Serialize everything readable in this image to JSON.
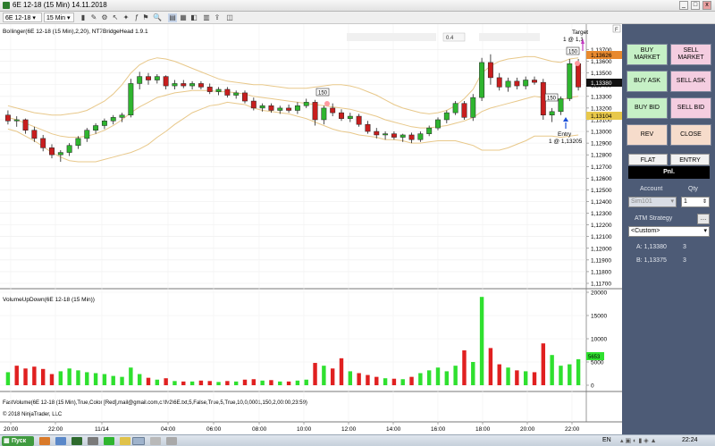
{
  "window": {
    "title": "6E 12-18 (15 Min)  14.11.2018"
  },
  "toolbar": {
    "instrument": "6E 12-18",
    "interval": "15 Min"
  },
  "indicators": {
    "price_label": "Bollinger(6E 12-18 (15 Min),2,20), NT7BridgeHead 1.9.1",
    "volume_label": "VolumeUpDown(6E 12-18 (15 Min))",
    "fastvolume_label": "FastVolume(6E 12-18 (15 Min),True,Color [Red],mail@gmail.com,c:\\fv2\\6E.txt,5,False,True,5,True,10,0,0001,150,2,00:00,23:59)",
    "copyright": "© 2018 NinjaTrader, LLC",
    "field_value": "0.4"
  },
  "price_axis": {
    "ticks": [
      "1,13700",
      "1,13600",
      "1,13500",
      "1,13400",
      "1,13300",
      "1,13200",
      "1,13100",
      "1,13000",
      "1,12900",
      "1,12800",
      "1,12700",
      "1,12600",
      "1,12500",
      "1,12400",
      "1,12300",
      "1,12200",
      "1,12100",
      "1,12000",
      "1,11900",
      "1,11800",
      "1,11700"
    ],
    "target_price": "1,13626",
    "last_price": "1,13380",
    "entry_price": "1,13104"
  },
  "volume_axis": {
    "ticks": [
      "20000",
      "15000",
      "10000",
      "5000",
      "0"
    ],
    "last_volume": "5653"
  },
  "time_axis": {
    "ticks": [
      "20:00",
      "22:00",
      "11/14",
      "04:00",
      "06:00",
      "08:00",
      "10:00",
      "12:00",
      "14:00",
      "16:00",
      "18:00",
      "20:00",
      "22:00"
    ]
  },
  "annotations": {
    "target_line1": "Target",
    "target_line2": "1 @ 1,1",
    "entry_line1": "Entry",
    "entry_line2": "1 @ 1,13205",
    "marker_a": "150",
    "marker_b": "150",
    "marker_c": "150"
  },
  "panel": {
    "buy_market": "BUY MARKET",
    "sell_market": "SELL MARKET",
    "buy_ask": "BUY ASK",
    "sell_ask": "SELL ASK",
    "buy_bid": "BUY BID",
    "sell_bid": "SELL BID",
    "rev": "REV",
    "close": "CLOSE",
    "flat": "FLAT",
    "entry": "ENTRY",
    "pnl": "Pnl.",
    "account_label": "Account",
    "qty_label": "Qty",
    "account_value": "Sim101",
    "qty_value": "1",
    "atm_label": "ATM Strategy",
    "atm_value": "<Custom>",
    "row_a_label": "A: 1,13380",
    "row_a_value": "3",
    "row_b_label": "B: 1,13375",
    "row_b_value": "3"
  },
  "taskbar": {
    "start_label": "Пуск",
    "lang": "EN",
    "clock": "22:24"
  },
  "colors": {
    "up_candle": "#2fb52f",
    "down_candle": "#c81e1e",
    "bollinger": "#e8c88a",
    "volume_up": "#2fe02f",
    "volume_down": "#e02020",
    "panel_bg": "#4d5b76"
  },
  "chart_data": {
    "type": "candlestick",
    "title": "",
    "ylim": [
      1.117,
      1.1375
    ],
    "volume_ylim": [
      0,
      20000
    ],
    "candles": [
      {
        "o": 1.1314,
        "h": 1.1318,
        "l": 1.1306,
        "c": 1.1309
      },
      {
        "o": 1.1309,
        "h": 1.1313,
        "l": 1.1304,
        "c": 1.131
      },
      {
        "o": 1.131,
        "h": 1.1311,
        "l": 1.1298,
        "c": 1.1301
      },
      {
        "o": 1.1301,
        "h": 1.1304,
        "l": 1.1291,
        "c": 1.1294
      },
      {
        "o": 1.1294,
        "h": 1.1297,
        "l": 1.1283,
        "c": 1.1286
      },
      {
        "o": 1.1286,
        "h": 1.1289,
        "l": 1.1277,
        "c": 1.128
      },
      {
        "o": 1.128,
        "h": 1.1284,
        "l": 1.1274,
        "c": 1.1282
      },
      {
        "o": 1.1282,
        "h": 1.129,
        "l": 1.1279,
        "c": 1.1288
      },
      {
        "o": 1.1288,
        "h": 1.1296,
        "l": 1.1285,
        "c": 1.1294
      },
      {
        "o": 1.1294,
        "h": 1.1303,
        "l": 1.1291,
        "c": 1.1301
      },
      {
        "o": 1.1301,
        "h": 1.1307,
        "l": 1.1298,
        "c": 1.1305
      },
      {
        "o": 1.1305,
        "h": 1.1311,
        "l": 1.1302,
        "c": 1.1309
      },
      {
        "o": 1.1309,
        "h": 1.1314,
        "l": 1.1306,
        "c": 1.1312
      },
      {
        "o": 1.1312,
        "h": 1.1316,
        "l": 1.1308,
        "c": 1.1314
      },
      {
        "o": 1.1314,
        "h": 1.1345,
        "l": 1.1312,
        "c": 1.1341
      },
      {
        "o": 1.1341,
        "h": 1.1351,
        "l": 1.1336,
        "c": 1.1347
      },
      {
        "o": 1.1347,
        "h": 1.135,
        "l": 1.134,
        "c": 1.1344
      },
      {
        "o": 1.1344,
        "h": 1.1349,
        "l": 1.1341,
        "c": 1.1347
      },
      {
        "o": 1.1347,
        "h": 1.1348,
        "l": 1.1336,
        "c": 1.1339
      },
      {
        "o": 1.1339,
        "h": 1.1344,
        "l": 1.1336,
        "c": 1.1341
      },
      {
        "o": 1.1341,
        "h": 1.1344,
        "l": 1.1337,
        "c": 1.1339
      },
      {
        "o": 1.1339,
        "h": 1.1343,
        "l": 1.1336,
        "c": 1.1341
      },
      {
        "o": 1.1341,
        "h": 1.1343,
        "l": 1.1336,
        "c": 1.1338
      },
      {
        "o": 1.1338,
        "h": 1.1341,
        "l": 1.1332,
        "c": 1.1334
      },
      {
        "o": 1.1334,
        "h": 1.1338,
        "l": 1.1331,
        "c": 1.1336
      },
      {
        "o": 1.1336,
        "h": 1.1338,
        "l": 1.1329,
        "c": 1.1331
      },
      {
        "o": 1.1331,
        "h": 1.1335,
        "l": 1.1328,
        "c": 1.1333
      },
      {
        "o": 1.1333,
        "h": 1.1335,
        "l": 1.1324,
        "c": 1.1326
      },
      {
        "o": 1.1326,
        "h": 1.1329,
        "l": 1.1318,
        "c": 1.132
      },
      {
        "o": 1.132,
        "h": 1.1324,
        "l": 1.1317,
        "c": 1.1322
      },
      {
        "o": 1.1322,
        "h": 1.1324,
        "l": 1.1316,
        "c": 1.1318
      },
      {
        "o": 1.1318,
        "h": 1.1322,
        "l": 1.1315,
        "c": 1.132
      },
      {
        "o": 1.132,
        "h": 1.1323,
        "l": 1.1316,
        "c": 1.1318
      },
      {
        "o": 1.1318,
        "h": 1.1325,
        "l": 1.1315,
        "c": 1.1322
      },
      {
        "o": 1.1322,
        "h": 1.1328,
        "l": 1.132,
        "c": 1.1325
      },
      {
        "o": 1.1325,
        "h": 1.1327,
        "l": 1.1305,
        "c": 1.131
      },
      {
        "o": 1.131,
        "h": 1.1322,
        "l": 1.1306,
        "c": 1.132
      },
      {
        "o": 1.132,
        "h": 1.1324,
        "l": 1.1313,
        "c": 1.1316
      },
      {
        "o": 1.1316,
        "h": 1.1319,
        "l": 1.1309,
        "c": 1.1311
      },
      {
        "o": 1.1311,
        "h": 1.1316,
        "l": 1.1308,
        "c": 1.1313
      },
      {
        "o": 1.1313,
        "h": 1.1315,
        "l": 1.1304,
        "c": 1.1306
      },
      {
        "o": 1.1306,
        "h": 1.1309,
        "l": 1.1298,
        "c": 1.13
      },
      {
        "o": 1.13,
        "h": 1.1303,
        "l": 1.1294,
        "c": 1.1297
      },
      {
        "o": 1.1297,
        "h": 1.13,
        "l": 1.1293,
        "c": 1.1298
      },
      {
        "o": 1.1298,
        "h": 1.13,
        "l": 1.1293,
        "c": 1.1295
      },
      {
        "o": 1.1295,
        "h": 1.1298,
        "l": 1.1291,
        "c": 1.1297
      },
      {
        "o": 1.1297,
        "h": 1.1299,
        "l": 1.129,
        "c": 1.1293
      },
      {
        "o": 1.1293,
        "h": 1.13,
        "l": 1.1291,
        "c": 1.1298
      },
      {
        "o": 1.1298,
        "h": 1.1305,
        "l": 1.1296,
        "c": 1.1303
      },
      {
        "o": 1.1303,
        "h": 1.1312,
        "l": 1.1301,
        "c": 1.131
      },
      {
        "o": 1.131,
        "h": 1.1318,
        "l": 1.1307,
        "c": 1.1316
      },
      {
        "o": 1.1316,
        "h": 1.1326,
        "l": 1.1314,
        "c": 1.1324
      },
      {
        "o": 1.1324,
        "h": 1.1326,
        "l": 1.131,
        "c": 1.1312
      },
      {
        "o": 1.1312,
        "h": 1.1332,
        "l": 1.1309,
        "c": 1.1329
      },
      {
        "o": 1.1329,
        "h": 1.1363,
        "l": 1.1326,
        "c": 1.1359
      },
      {
        "o": 1.1359,
        "h": 1.1366,
        "l": 1.134,
        "c": 1.1346
      },
      {
        "o": 1.1346,
        "h": 1.135,
        "l": 1.1335,
        "c": 1.1338
      },
      {
        "o": 1.1338,
        "h": 1.1346,
        "l": 1.1334,
        "c": 1.1343
      },
      {
        "o": 1.1343,
        "h": 1.1346,
        "l": 1.1336,
        "c": 1.1339
      },
      {
        "o": 1.1339,
        "h": 1.1347,
        "l": 1.1336,
        "c": 1.1344
      },
      {
        "o": 1.1344,
        "h": 1.1347,
        "l": 1.134,
        "c": 1.1342
      },
      {
        "o": 1.1342,
        "h": 1.1345,
        "l": 1.131,
        "c": 1.1314
      },
      {
        "o": 1.1314,
        "h": 1.132,
        "l": 1.1308,
        "c": 1.1317
      },
      {
        "o": 1.1317,
        "h": 1.133,
        "l": 1.1314,
        "c": 1.1328
      },
      {
        "o": 1.1328,
        "h": 1.1362,
        "l": 1.1326,
        "c": 1.1358
      },
      {
        "o": 1.1358,
        "h": 1.1362,
        "l": 1.1335,
        "c": 1.1338
      }
    ],
    "volume": [
      {
        "v": 2800,
        "up": true
      },
      {
        "v": 4200,
        "up": false
      },
      {
        "v": 3600,
        "up": false
      },
      {
        "v": 4000,
        "up": false
      },
      {
        "v": 3500,
        "up": false
      },
      {
        "v": 2400,
        "up": false
      },
      {
        "v": 3000,
        "up": true
      },
      {
        "v": 3600,
        "up": true
      },
      {
        "v": 3200,
        "up": true
      },
      {
        "v": 2800,
        "up": true
      },
      {
        "v": 2600,
        "up": true
      },
      {
        "v": 2400,
        "up": true
      },
      {
        "v": 2000,
        "up": true
      },
      {
        "v": 1800,
        "up": true
      },
      {
        "v": 3800,
        "up": true
      },
      {
        "v": 2400,
        "up": true
      },
      {
        "v": 1600,
        "up": false
      },
      {
        "v": 1200,
        "up": true
      },
      {
        "v": 1500,
        "up": false
      },
      {
        "v": 900,
        "up": true
      },
      {
        "v": 800,
        "up": false
      },
      {
        "v": 800,
        "up": true
      },
      {
        "v": 1000,
        "up": false
      },
      {
        "v": 900,
        "up": false
      },
      {
        "v": 700,
        "up": true
      },
      {
        "v": 900,
        "up": false
      },
      {
        "v": 800,
        "up": true
      },
      {
        "v": 1200,
        "up": false
      },
      {
        "v": 1300,
        "up": false
      },
      {
        "v": 1000,
        "up": true
      },
      {
        "v": 1100,
        "up": false
      },
      {
        "v": 800,
        "up": true
      },
      {
        "v": 800,
        "up": false
      },
      {
        "v": 1000,
        "up": true
      },
      {
        "v": 1200,
        "up": true
      },
      {
        "v": 4800,
        "up": false
      },
      {
        "v": 4200,
        "up": true
      },
      {
        "v": 3600,
        "up": false
      },
      {
        "v": 5800,
        "up": false
      },
      {
        "v": 3000,
        "up": true
      },
      {
        "v": 2600,
        "up": false
      },
      {
        "v": 2200,
        "up": false
      },
      {
        "v": 1800,
        "up": false
      },
      {
        "v": 1500,
        "up": true
      },
      {
        "v": 1400,
        "up": false
      },
      {
        "v": 1300,
        "up": true
      },
      {
        "v": 1800,
        "up": false
      },
      {
        "v": 2600,
        "up": true
      },
      {
        "v": 3200,
        "up": true
      },
      {
        "v": 3800,
        "up": true
      },
      {
        "v": 3000,
        "up": true
      },
      {
        "v": 4200,
        "up": true
      },
      {
        "v": 7500,
        "up": false
      },
      {
        "v": 5000,
        "up": true
      },
      {
        "v": 19000,
        "up": true
      },
      {
        "v": 8000,
        "up": false
      },
      {
        "v": 4500,
        "up": false
      },
      {
        "v": 3800,
        "up": true
      },
      {
        "v": 3200,
        "up": false
      },
      {
        "v": 3000,
        "up": true
      },
      {
        "v": 2800,
        "up": false
      },
      {
        "v": 9000,
        "up": false
      },
      {
        "v": 6500,
        "up": true
      },
      {
        "v": 4200,
        "up": true
      },
      {
        "v": 4500,
        "up": true
      },
      {
        "v": 5600,
        "up": true
      }
    ],
    "bollinger": {
      "upper": [
        1.1322,
        1.132,
        1.1318,
        1.1316,
        1.1315,
        1.1314,
        1.1314,
        1.1315,
        1.1316,
        1.1318,
        1.1322,
        1.1326,
        1.1332,
        1.134,
        1.135,
        1.1357,
        1.1361,
        1.1363,
        1.1362,
        1.136,
        1.1357,
        1.1354,
        1.1351,
        1.1348,
        1.1345,
        1.1343,
        1.1342,
        1.1341,
        1.134,
        1.134,
        1.1339,
        1.1338,
        1.1337,
        1.1337,
        1.1337,
        1.1338,
        1.1339,
        1.134,
        1.134,
        1.1339,
        1.1337,
        1.1334,
        1.1331,
        1.1327,
        1.1323,
        1.132,
        1.1318,
        1.1316,
        1.1315,
        1.1316,
        1.1318,
        1.1322,
        1.1328,
        1.1336,
        1.135,
        1.1356,
        1.136,
        1.1362,
        1.1363,
        1.1364,
        1.1364,
        1.1362,
        1.136,
        1.1359,
        1.1362,
        1.1363
      ],
      "middle": [
        1.1312,
        1.131,
        1.1307,
        1.1304,
        1.1301,
        1.1298,
        1.1296,
        1.1295,
        1.1295,
        1.1296,
        1.1298,
        1.1301,
        1.1305,
        1.131,
        1.1316,
        1.1321,
        1.1325,
        1.1329,
        1.1331,
        1.1333,
        1.1334,
        1.1335,
        1.1335,
        1.1335,
        1.1334,
        1.1334,
        1.1333,
        1.1332,
        1.133,
        1.1329,
        1.1328,
        1.1327,
        1.1326,
        1.1325,
        1.1324,
        1.1323,
        1.1322,
        1.1321,
        1.132,
        1.1319,
        1.1317,
        1.1315,
        1.1313,
        1.131,
        1.1308,
        1.1306,
        1.1304,
        1.1303,
        1.1303,
        1.1304,
        1.1305,
        1.1307,
        1.1309,
        1.1312,
        1.1317,
        1.132,
        1.1322,
        1.1324,
        1.1326,
        1.1328,
        1.133,
        1.1329,
        1.1328,
        1.1327,
        1.1329,
        1.133
      ],
      "lower": [
        1.1302,
        1.13,
        1.1296,
        1.1292,
        1.1287,
        1.1282,
        1.1278,
        1.1275,
        1.1274,
        1.1274,
        1.1274,
        1.1276,
        1.1278,
        1.128,
        1.1282,
        1.1285,
        1.1289,
        1.1295,
        1.13,
        1.1306,
        1.1311,
        1.1316,
        1.1319,
        1.1322,
        1.1323,
        1.1325,
        1.1324,
        1.1323,
        1.132,
        1.1318,
        1.1317,
        1.1316,
        1.1315,
        1.1313,
        1.1311,
        1.1308,
        1.1305,
        1.1302,
        1.13,
        1.1299,
        1.1297,
        1.1296,
        1.1295,
        1.1293,
        1.1293,
        1.1292,
        1.129,
        1.129,
        1.1291,
        1.1292,
        1.1292,
        1.1292,
        1.129,
        1.1288,
        1.1284,
        1.1284,
        1.1284,
        1.1286,
        1.1289,
        1.1292,
        1.1296,
        1.1296,
        1.1296,
        1.1295,
        1.1296,
        1.1297
      ]
    }
  }
}
